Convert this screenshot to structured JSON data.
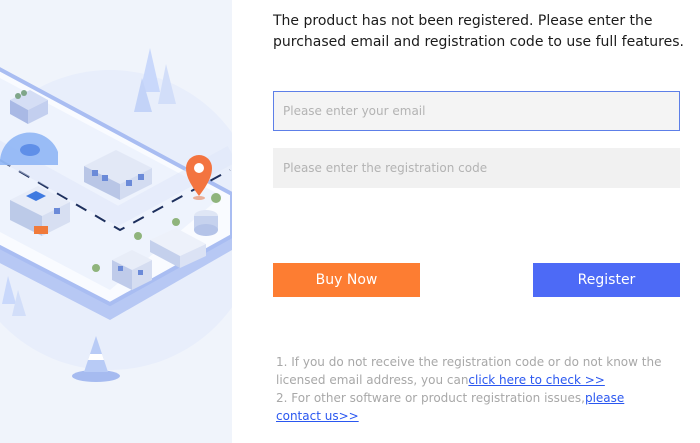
{
  "notice": "The product has not been registered. Please enter the purchased email and registration code to use full features.",
  "email": {
    "placeholder": "Please enter your email",
    "value": ""
  },
  "registration_code": {
    "placeholder": "Please enter the registration code",
    "value": ""
  },
  "buttons": {
    "buy": "Buy Now",
    "register": "Register"
  },
  "help": {
    "line1_text": "1. If you do not receive the registration code or do not know the licensed email address, you can",
    "line1_link": "click here to check >>",
    "line2_text": "2. For other software or product registration issues,",
    "line2_link": "please contact us>>"
  },
  "colors": {
    "buy": "#fd7d32",
    "register": "#4d6af6",
    "link": "#2a57f0",
    "focus_border": "#5d7fe8"
  },
  "illustration": {
    "icons": [
      "map-pin-icon",
      "traffic-cone-icon",
      "dome-icon",
      "tree-icon"
    ]
  }
}
